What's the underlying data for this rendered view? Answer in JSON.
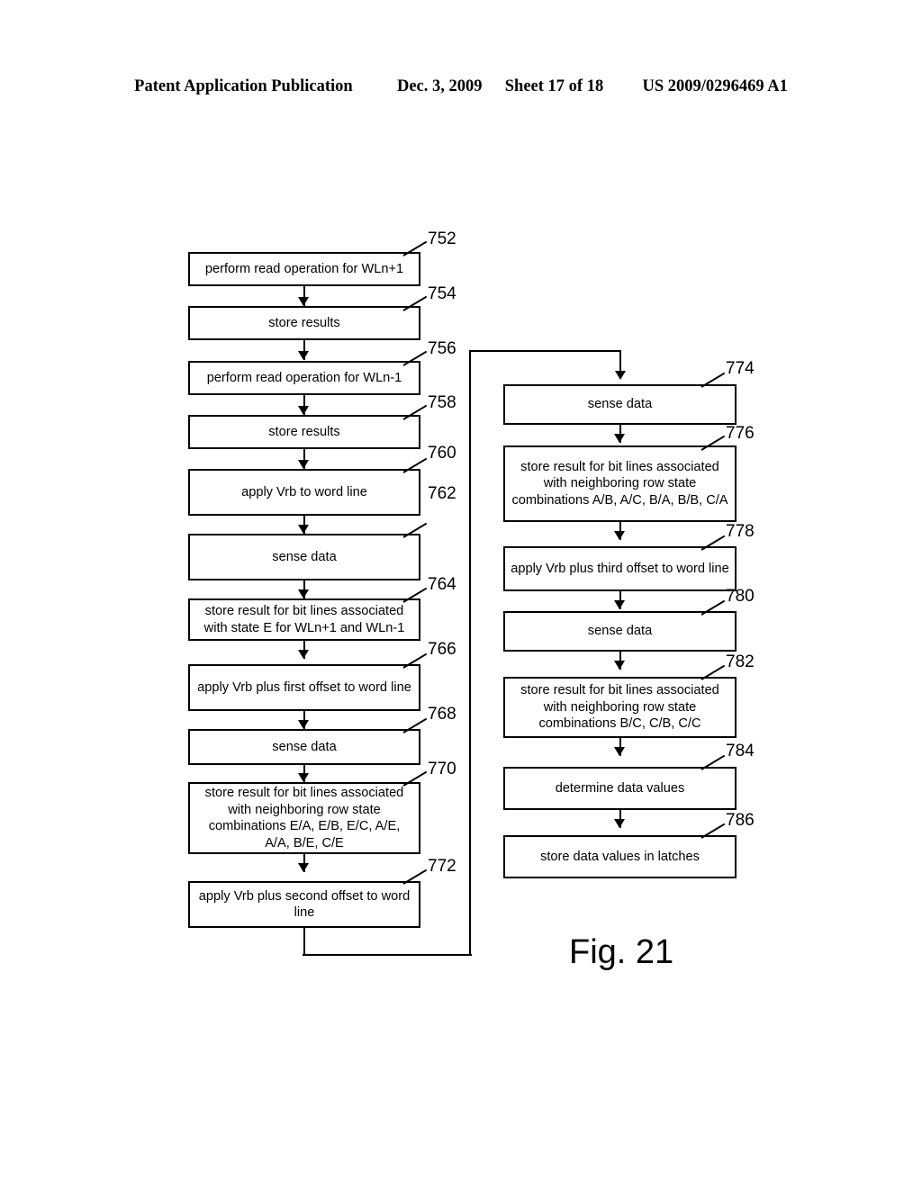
{
  "header": {
    "publication": "Patent Application Publication",
    "date": "Dec. 3, 2009",
    "sheet": "Sheet 17 of 18",
    "patent_number": "US 2009/0296469 A1"
  },
  "figure": {
    "caption": "Fig. 21"
  },
  "flowchart": {
    "left_column": [
      {
        "ref": "752",
        "text": "perform read operation for WLn+1"
      },
      {
        "ref": "754",
        "text": "store results"
      },
      {
        "ref": "756",
        "text": "perform read operation for WLn-1"
      },
      {
        "ref": "758",
        "text": "store results"
      },
      {
        "ref": "760",
        "text": "apply Vrb to word line"
      },
      {
        "ref": "762",
        "text": "sense data"
      },
      {
        "ref": "764",
        "text": "store result for bit lines associated with state E for WLn+1 and WLn-1"
      },
      {
        "ref": "766",
        "text": "apply Vrb plus first offset to word line"
      },
      {
        "ref": "768",
        "text": "sense data"
      },
      {
        "ref": "770",
        "text": "store result for bit lines associated with neighboring row state combinations E/A, E/B, E/C, A/E, A/A, B/E, C/E"
      },
      {
        "ref": "772",
        "text": "apply Vrb plus second offset to word line"
      }
    ],
    "right_column": [
      {
        "ref": "774",
        "text": "sense data"
      },
      {
        "ref": "776",
        "text": "store result for bit lines associated with neighboring row state combinations A/B, A/C, B/A, B/B, C/A"
      },
      {
        "ref": "778",
        "text": "apply Vrb plus third offset to word line"
      },
      {
        "ref": "780",
        "text": "sense data"
      },
      {
        "ref": "782",
        "text": "store result for bit lines associated with neighboring row state combinations B/C, C/B, C/C"
      },
      {
        "ref": "784",
        "text": "determine data values"
      },
      {
        "ref": "786",
        "text": "store data values in latches"
      }
    ]
  },
  "colors": {
    "ink": "#000000",
    "paper": "#ffffff"
  }
}
